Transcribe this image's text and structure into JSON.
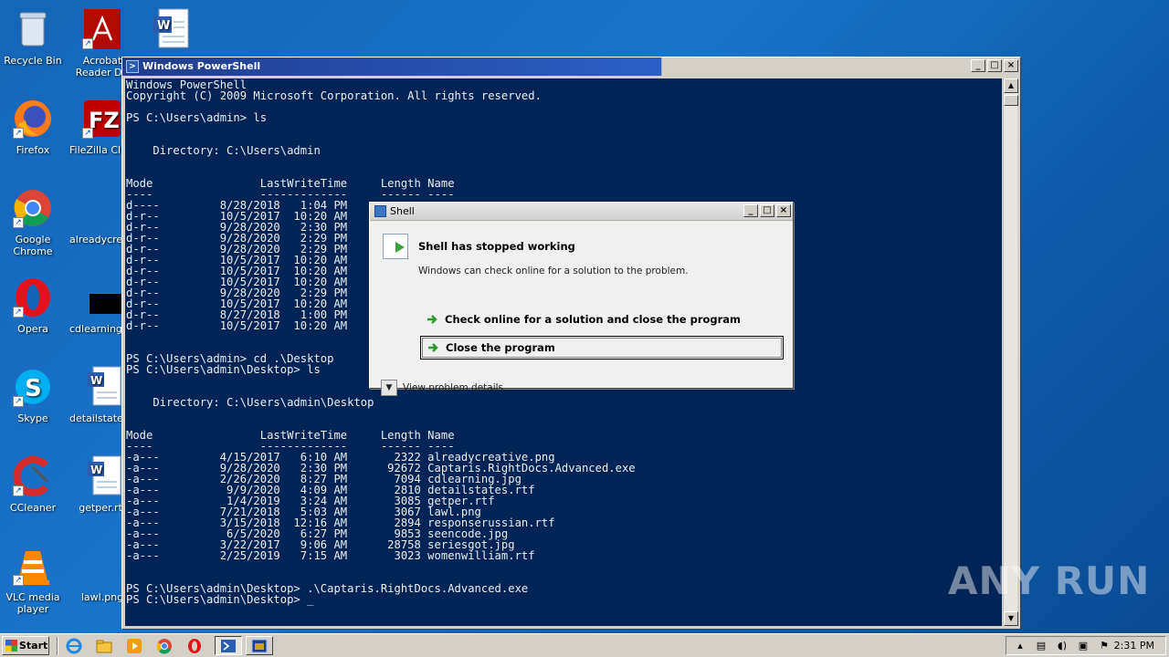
{
  "desktop_icons": [
    {
      "name": "recycle-bin",
      "label": "Recycle Bin",
      "icon": "recycle-bin-icon"
    },
    {
      "name": "acrobat-reader",
      "label": "Acrobat Reader DC",
      "icon": "acrobat-icon"
    },
    {
      "name": "word-doc-top",
      "label": "",
      "icon": "word-document-icon"
    },
    {
      "name": "firefox",
      "label": "Firefox",
      "icon": "firefox-icon"
    },
    {
      "name": "filezilla",
      "label": "FileZilla Client",
      "icon": "filezilla-icon"
    },
    {
      "name": "google-chrome",
      "label": "Google Chrome",
      "icon": "chrome-icon"
    },
    {
      "name": "alreadycreative",
      "label": "alreadycreati...",
      "icon": "image-file-icon"
    },
    {
      "name": "opera",
      "label": "Opera",
      "icon": "opera-icon"
    },
    {
      "name": "cdlearning",
      "label": "cdlearning.j...",
      "icon": "image-file-icon"
    },
    {
      "name": "skype",
      "label": "Skype",
      "icon": "skype-icon"
    },
    {
      "name": "detailstates",
      "label": "detailstates...",
      "icon": "word-document-icon"
    },
    {
      "name": "ccleaner",
      "label": "CCleaner",
      "icon": "ccleaner-icon"
    },
    {
      "name": "getper",
      "label": "getper.rtf",
      "icon": "word-document-icon"
    },
    {
      "name": "vlc",
      "label": "VLC media player",
      "icon": "vlc-icon"
    },
    {
      "name": "lawl",
      "label": "lawl.png",
      "icon": "image-file-icon"
    }
  ],
  "powershell": {
    "title": "Windows PowerShell",
    "buttons": {
      "minimize": "_",
      "maximize": "□",
      "close": "×"
    },
    "console_text": "Windows PowerShell\nCopyright (C) 2009 Microsoft Corporation. All rights reserved.\n\nPS C:\\Users\\admin> ls\n\n\n    Directory: C:\\Users\\admin\n\n\nMode                LastWriteTime     Length Name\n----                -------------     ------ ----\nd----         8/28/2018   1:04 PM\nd-r--         10/5/2017  10:20 AM\nd-r--         9/28/2020   2:30 PM\nd-r--         9/28/2020   2:29 PM\nd-r--         9/28/2020   2:29 PM\nd-r--         10/5/2017  10:20 AM\nd-r--         10/5/2017  10:20 AM\nd-r--         10/5/2017  10:20 AM\nd-r--         9/28/2020   2:29 PM\nd-r--         10/5/2017  10:20 AM\nd-r--         8/27/2018   1:00 PM\nd-r--         10/5/2017  10:20 AM\n\n\nPS C:\\Users\\admin> cd .\\Desktop\nPS C:\\Users\\admin\\Desktop> ls\n\n\n    Directory: C:\\Users\\admin\\Desktop\n\n\nMode                LastWriteTime     Length Name\n----                -------------     ------ ----\n-a---         4/15/2017   6:10 AM       2322 alreadycreative.png\n-a---         9/28/2020   2:30 PM      92672 Captaris.RightDocs.Advanced.exe\n-a---         2/26/2020   8:27 PM       7094 cdlearning.jpg\n-a---          9/9/2020   4:09 AM       2810 detailstates.rtf\n-a---          1/4/2019   3:24 AM       3085 getper.rtf\n-a---         7/21/2018   5:03 AM       3067 lawl.png\n-a---         3/15/2018  12:16 AM       2894 responserussian.rtf\n-a---          6/5/2020   6:27 PM       9853 seencode.jpg\n-a---         3/22/2017   9:06 AM      28758 seriesgot.jpg\n-a---         2/25/2019   7:15 AM       3023 womenwilliam.rtf\n\n\nPS C:\\Users\\admin\\Desktop> .\\Captaris.RightDocs.Advanced.exe\nPS C:\\Users\\admin\\Desktop> _"
  },
  "dialog": {
    "title": "Shell",
    "heading": "Shell has stopped working",
    "subtext": "Windows can check online for a solution to the problem.",
    "option_check_online": "Check online for a solution and close the program",
    "option_close": "Close the program",
    "details": "View problem details"
  },
  "watermark": "ANY RUN",
  "taskbar": {
    "start_label": "Start",
    "clock": "2:31 PM"
  },
  "colors": {
    "console_bg": "#012456",
    "console_fg": "#eeedf0",
    "desktop_bg": "#1a6cc4"
  }
}
